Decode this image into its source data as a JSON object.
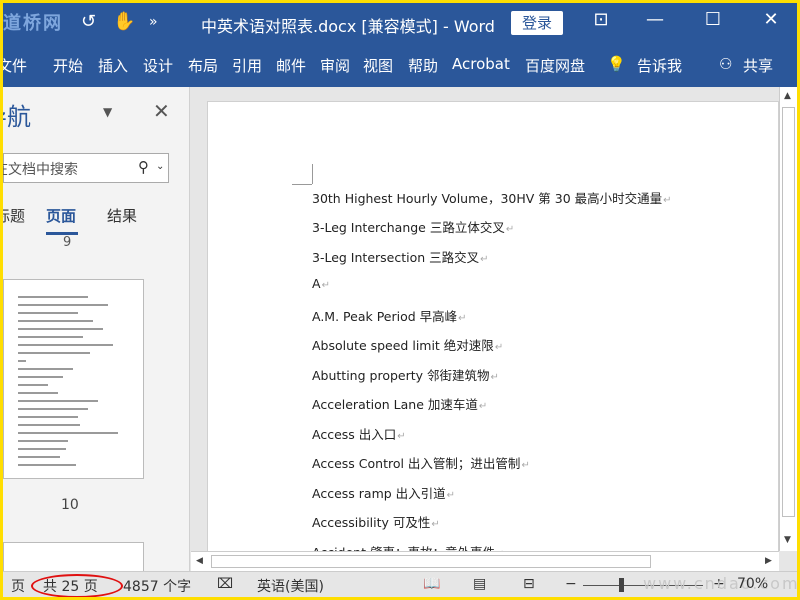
{
  "titlebar": {
    "logo": "道桥网",
    "title": "中英术语对照表.docx [兼容模式] - Word",
    "login": "登录"
  },
  "ribbon": {
    "tabs": [
      "文件",
      "开始",
      "插入",
      "设计",
      "布局",
      "引用",
      "邮件",
      "审阅",
      "视图",
      "帮助",
      "Acrobat",
      "百度网盘"
    ],
    "tell_me": "告诉我",
    "share": "共享"
  },
  "nav": {
    "title": "导航",
    "search_placeholder": "在文档中搜索",
    "tabs": [
      "标题",
      "页面",
      "结果"
    ],
    "page_above": "9",
    "page_thumb": "10"
  },
  "document": {
    "lines": [
      "30th Highest Hourly Volume，30HV 第 30 最高小时交通量",
      "3-Leg Interchange 三路立体交叉",
      "3-Leg Intersection 三路交叉",
      "A",
      "A.M. Peak Period 早高峰",
      "Absolute speed limit 绝对速限",
      "Abutting property 邻街建筑物",
      "Acceleration Lane 加速车道",
      "Access 出入口",
      "Access Control 出入管制；进出管制",
      "Access ramp 出入引道",
      "Accessibility 可及性",
      "Accident 肇事；事故；意外事件"
    ],
    "paragraph_mark": "↵"
  },
  "status": {
    "page_label": "页",
    "page_count": "共 25 页",
    "word_count": "4857 个字",
    "language": "英语(美国)",
    "zoom": "70%"
  },
  "watermark": "www.cndao.com"
}
